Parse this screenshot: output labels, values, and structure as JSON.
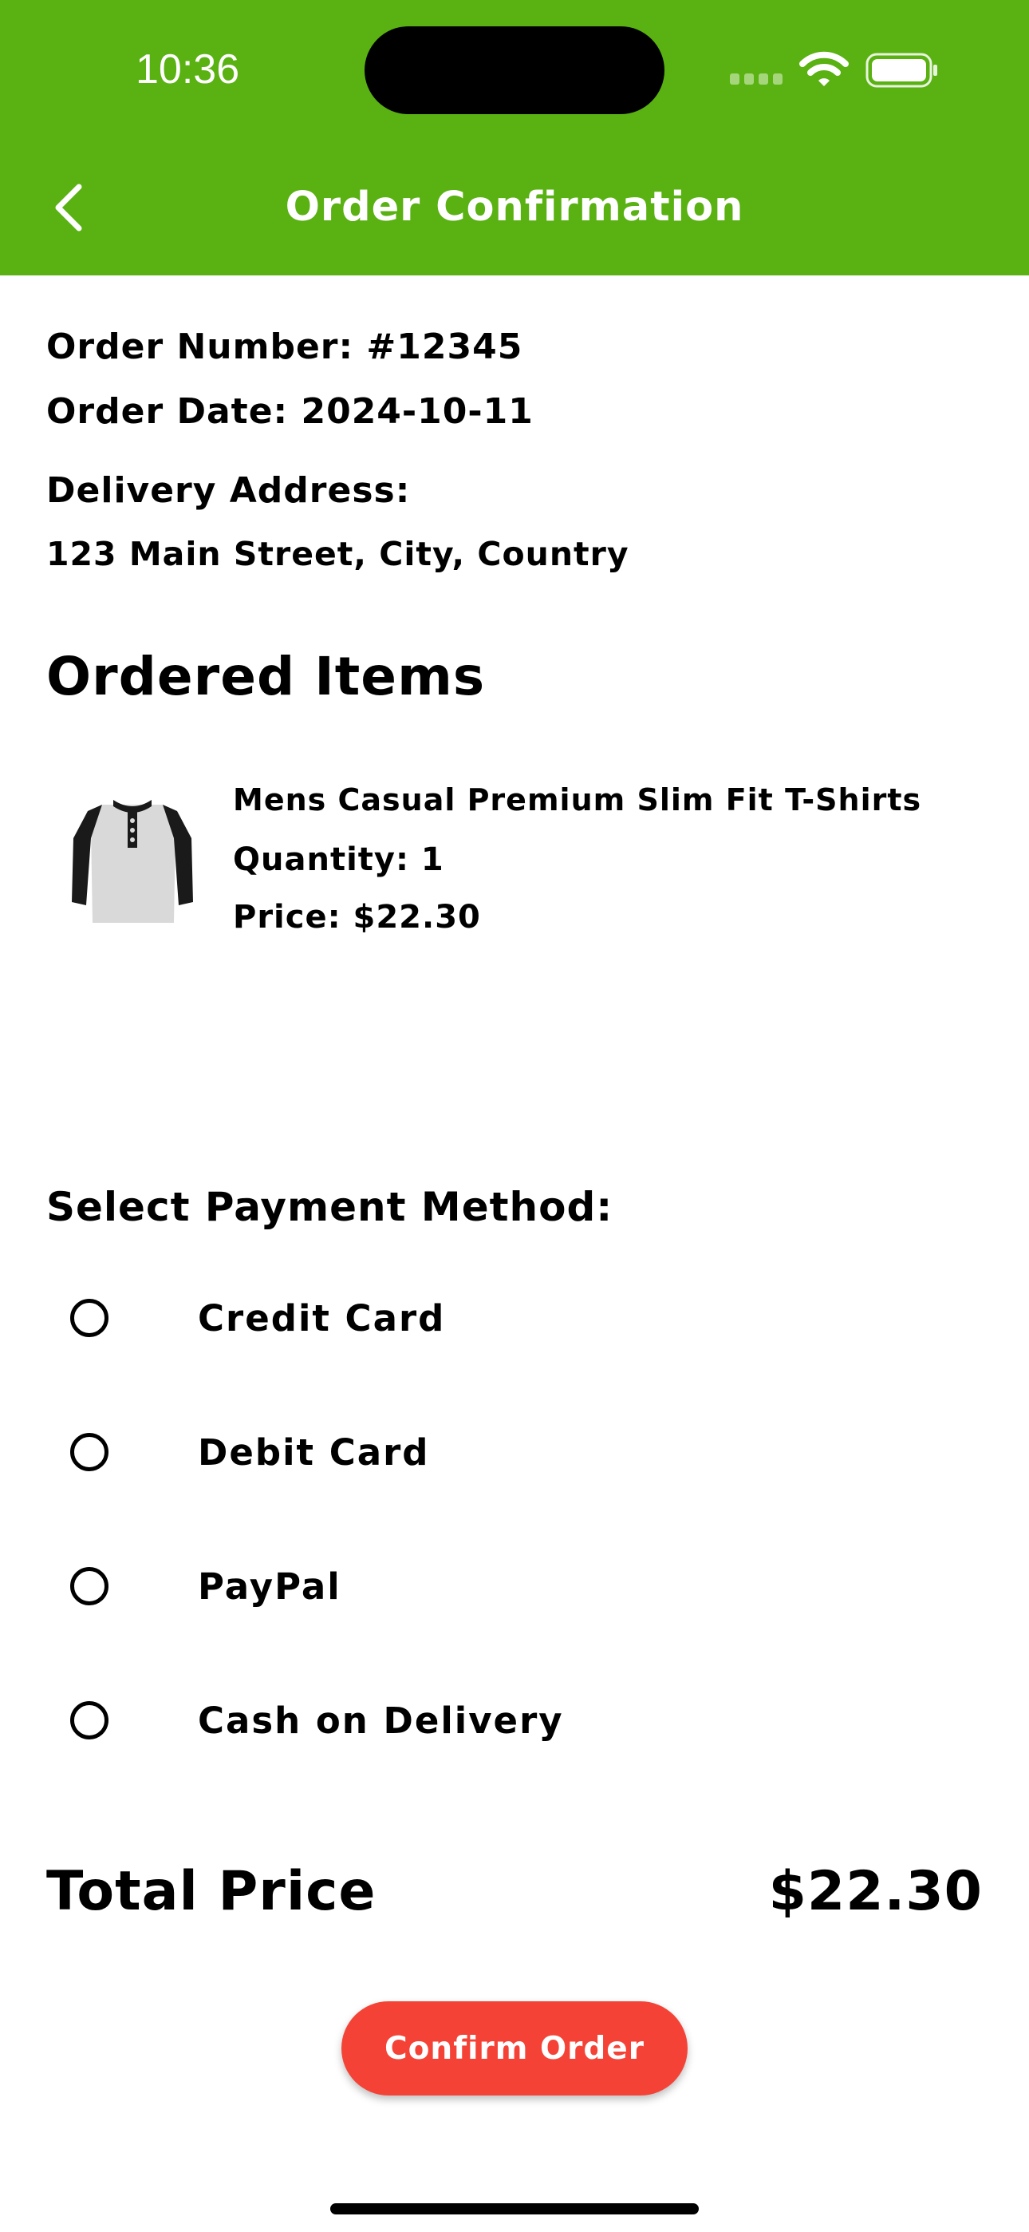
{
  "colors": {
    "header_bg": "#5ab112",
    "accent_button": "#f44336"
  },
  "status_bar": {
    "time": "10:36",
    "icons": [
      "cellular-signal-icon",
      "wifi-icon",
      "battery-icon"
    ]
  },
  "nav": {
    "title": "Order Confirmation",
    "back_icon": "chevron-left-icon"
  },
  "order": {
    "number": "Order Number: #12345",
    "date": "Order Date: 2024-10-11",
    "address_label": "Delivery Address:",
    "address": "123 Main Street, City, Country"
  },
  "items_section": {
    "title": "Ordered Items",
    "items": [
      {
        "name": "Mens Casual Premium Slim Fit T-Shirts",
        "quantity": "Quantity: 1",
        "price": "Price: $22.30",
        "image_icon": "henley-shirt-image"
      }
    ]
  },
  "payment": {
    "title": "Select Payment Method:",
    "selected": null,
    "options": [
      "Credit Card",
      "Debit Card",
      "PayPal",
      "Cash on Delivery"
    ]
  },
  "total": {
    "label": "Total Price",
    "value": "$22.30"
  },
  "confirm_button": {
    "label": "Confirm Order"
  }
}
